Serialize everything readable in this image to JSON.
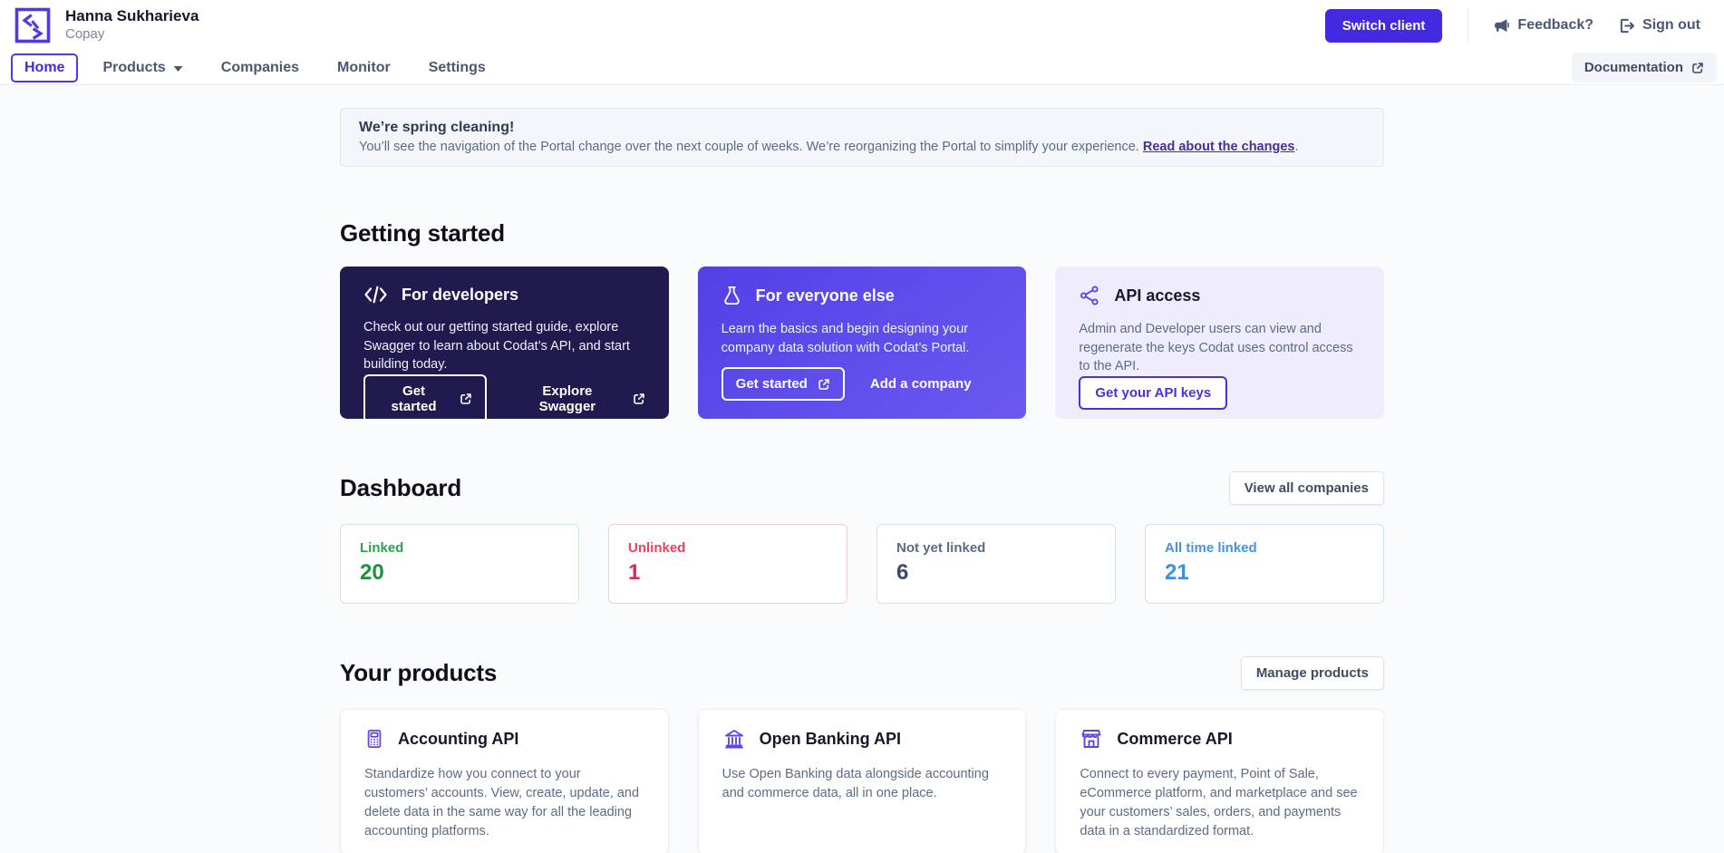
{
  "header": {
    "user_name": "Hanna Sukharieva",
    "client_name": "Copay",
    "switch_client_label": "Switch client",
    "feedback_label": "Feedback?",
    "sign_out_label": "Sign out"
  },
  "nav": {
    "items": [
      {
        "label": "Home",
        "active": true
      },
      {
        "label": "Products",
        "has_dropdown": true
      },
      {
        "label": "Companies"
      },
      {
        "label": "Monitor"
      },
      {
        "label": "Settings"
      }
    ],
    "documentation_label": "Documentation"
  },
  "banner": {
    "title": "We’re spring cleaning!",
    "body": "You’ll see the navigation of the Portal change over the next couple of weeks. We’re reorganizing the Portal to simplify your experience. ",
    "link_text": "Read about the changes",
    "suffix": "."
  },
  "getting_started": {
    "title": "Getting started",
    "cards": [
      {
        "icon": "code-icon",
        "title": "For developers",
        "body": "Check out our getting started guide, explore Swagger to learn about Codat’s API, and start building today.",
        "primary_button": "Get started",
        "secondary_button": "Explore Swagger"
      },
      {
        "icon": "flask-icon",
        "title": "For everyone else",
        "body": "Learn the basics and begin designing your company data solution with Codat’s Portal.",
        "primary_button": "Get started",
        "secondary_button": "Add a company"
      },
      {
        "icon": "share-nodes-icon",
        "title": "API access",
        "body": "Admin and Developer users can view and regenerate the keys Codat uses control access to the API.",
        "primary_button": "Get your API keys"
      }
    ]
  },
  "dashboard": {
    "title": "Dashboard",
    "view_all_label": "View all companies",
    "stats": [
      {
        "label": "Linked",
        "value": "20",
        "color": "#1d9140"
      },
      {
        "label": "Unlinked",
        "value": "1",
        "color": "#d9285a"
      },
      {
        "label": "Not yet linked",
        "value": "6",
        "color": "#3a4a66"
      },
      {
        "label": "All time linked",
        "value": "21",
        "color": "#3e8fe0"
      }
    ]
  },
  "products": {
    "title": "Your products",
    "manage_label": "Manage products",
    "cards": [
      {
        "icon": "calculator-icon",
        "title": "Accounting API",
        "body": "Standardize how you connect to your customers’ accounts. View, create, update, and delete data in the same way for all the leading accounting platforms."
      },
      {
        "icon": "bank-icon",
        "title": "Open Banking API",
        "body": "Use Open Banking data alongside accounting and commerce data, all in one place."
      },
      {
        "icon": "storefront-icon",
        "title": "Commerce API",
        "body": "Connect to every payment, Point of Sale, eCommerce platform, and marketplace and see your customers’ sales, orders, and payments data in a standardized format."
      }
    ]
  },
  "colors": {
    "accent_purple": "#432ae0",
    "link_purple": "#4c2b9c",
    "dark_card_bg": "#211a4e",
    "purple_card_bg": "#5a48ea",
    "light_card_bg": "#efedfb",
    "linked_green": "#1d9140",
    "unlinked_red": "#d9285a",
    "not_yet_linked_slate": "#3a4a66",
    "all_time_linked_blue": "#3e8fe0"
  }
}
